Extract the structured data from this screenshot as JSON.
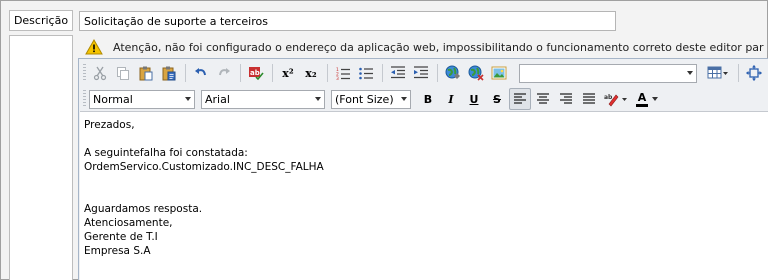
{
  "form": {
    "description_label": "Descrição",
    "subject_value": "Solicitação de suporte a terceiros"
  },
  "warning": {
    "icon": "warning-triangle",
    "text": "Atenção, não foi configurado o endereço da aplicação web, impossibilitando o funcionamento correto deste editor par"
  },
  "toolbar": {
    "font_format": "Normal",
    "font_name": "Arial",
    "font_size": "(Font Size)",
    "style_combo": "",
    "bold_label": "B",
    "italic_label": "I",
    "underline_label": "U",
    "strike_label": "S",
    "superscript_label": "x²",
    "subscript_label": "x₂",
    "font_color_label": "A"
  },
  "body_lines": [
    "Prezados,",
    "",
    "A seguintefalha foi constatada:",
    "OrdemServico.Customizado.INC_DESC_FALHA",
    "",
    "",
    "Aguardamos resposta.",
    "Atenciosamente,",
    "Gerente de T.I",
    "Empresa S.A"
  ],
  "colors": {
    "warning": "#f5c400",
    "font_color_bar": "#000000",
    "highlight": "#e03030"
  }
}
